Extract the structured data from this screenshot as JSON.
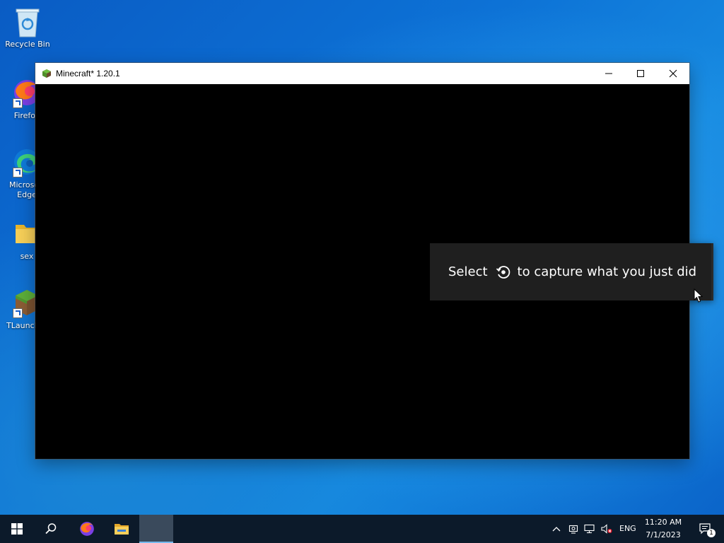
{
  "desktop": {
    "icons": [
      {
        "label": "Recycle Bin",
        "icon": "recycle-bin-icon"
      },
      {
        "label": "Firefox",
        "icon": "firefox-icon"
      },
      {
        "label": "Microsoft Edge",
        "icon": "edge-icon"
      },
      {
        "label": "sex",
        "icon": "folder-icon"
      },
      {
        "label": "TLauncher",
        "icon": "tlauncher-icon"
      }
    ]
  },
  "window": {
    "title": "Minecraft* 1.20.1",
    "icon": "minecraft-grass-block-icon"
  },
  "toast": {
    "text_before": "Select",
    "icon": "capture-icon",
    "text_after": "to capture what you just did"
  },
  "taskbar": {
    "buttons": [
      "start-icon",
      "search-icon",
      "firefox-icon",
      "file-explorer-icon",
      "minecraft-window"
    ],
    "tray": {
      "language": "ENG",
      "time": "11:20 AM",
      "date": "7/1/2023",
      "notifications_count": "1"
    }
  },
  "colors": {
    "accent": "#0078d7",
    "toast_bg": "#1f1f1f",
    "taskbar_bg": "#0c1a2a"
  }
}
